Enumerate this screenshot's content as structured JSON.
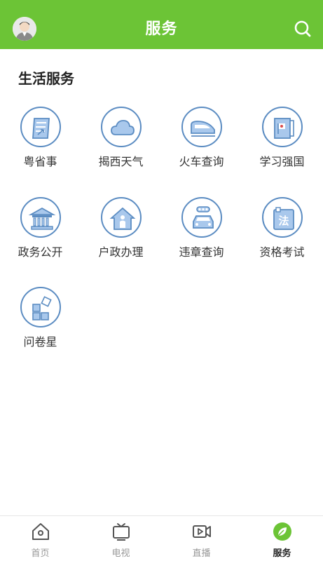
{
  "header": {
    "title": "服务",
    "avatar_icon": "user-avatar",
    "search_icon": "search-icon"
  },
  "section": {
    "title": "生活服务"
  },
  "services": [
    {
      "label": "粤省事",
      "icon": "yue-shengshi-icon"
    },
    {
      "label": "揭西天气",
      "icon": "cloud-icon"
    },
    {
      "label": "火车查询",
      "icon": "train-icon"
    },
    {
      "label": "学习强国",
      "icon": "book-flag-icon"
    },
    {
      "label": "政务公开",
      "icon": "government-building-icon"
    },
    {
      "label": "户政办理",
      "icon": "house-person-icon"
    },
    {
      "label": "违章查询",
      "icon": "car-traffic-icon"
    },
    {
      "label": "资格考试",
      "icon": "law-book-icon"
    },
    {
      "label": "问卷星",
      "icon": "grid-blocks-icon"
    }
  ],
  "tabbar": {
    "items": [
      {
        "label": "首页",
        "icon": "home-icon",
        "active": false
      },
      {
        "label": "电视",
        "icon": "tv-icon",
        "active": false
      },
      {
        "label": "直播",
        "icon": "video-play-icon",
        "active": false
      },
      {
        "label": "服务",
        "icon": "leaf-icon",
        "active": true
      }
    ]
  },
  "colors": {
    "brand_green": "#6cc436",
    "icon_blue": "#5b8cc2",
    "icon_fill": "#a9c8ec"
  }
}
